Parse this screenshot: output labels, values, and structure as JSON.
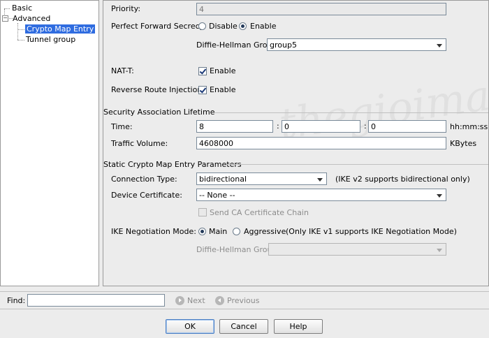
{
  "tree": {
    "items": [
      {
        "label": "Basic"
      },
      {
        "label": "Advanced"
      },
      {
        "label": "Crypto Map Entry"
      },
      {
        "label": "Tunnel group"
      }
    ]
  },
  "form": {
    "priority": {
      "label": "Priority:",
      "value": "4"
    },
    "pfs": {
      "label": "Perfect Forward Secrecy:",
      "options": [
        "Disable",
        "Enable"
      ],
      "selected": "Enable"
    },
    "dh_group": {
      "label": "Diffie-Hellman Group:",
      "value": "group5"
    },
    "nat_t": {
      "label": "NAT-T:",
      "checkbox_label": "Enable",
      "checked": true
    },
    "rri": {
      "label": "Reverse Route Injection:",
      "checkbox_label": "Enable",
      "checked": true
    },
    "sa_lifetime": {
      "section_title": "Security Association Lifetime",
      "time_label": "Time:",
      "hours": "8",
      "minutes": "0",
      "seconds": "0",
      "separator": ":",
      "time_unit": "hh:mm:ss",
      "volume_label": "Traffic Volume:",
      "volume_value": "4608000",
      "volume_unit": "KBytes"
    },
    "static_params": {
      "section_title": "Static Crypto Map Entry Parameters",
      "connection_type_label": "Connection Type:",
      "connection_type_value": "bidirectional",
      "connection_type_note": "(IKE v2 supports bidirectional only)",
      "device_cert_label": "Device Certificate:",
      "device_cert_value": "-- None --",
      "send_ca_chain_label": "Send CA Certificate Chain",
      "ike_mode_label": "IKE Negotiation Mode:",
      "ike_mode_options": [
        "Main",
        "Aggressive"
      ],
      "ike_mode_selected": "Main",
      "ike_mode_note": "(Only IKE v1 supports IKE Negotiation Mode)",
      "dh_group_label": "Diffie-Hellman Group:",
      "dh_group_value": ""
    }
  },
  "find": {
    "label": "Find:",
    "value": "",
    "next_label": "Next",
    "previous_label": "Previous"
  },
  "buttons": {
    "ok": "OK",
    "cancel": "Cancel",
    "help": "Help"
  },
  "watermark": "thegioimang.vn",
  "colors": {
    "selection": "#2f6ce0",
    "window_bg": "#ececec"
  }
}
